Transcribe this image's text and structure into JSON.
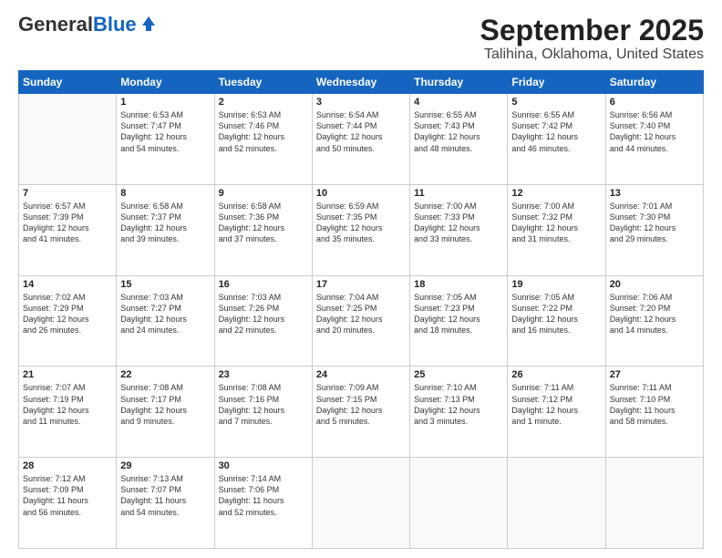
{
  "logo": {
    "line1": "General",
    "line2": "Blue"
  },
  "title": "September 2025",
  "subtitle": "Talihina, Oklahoma, United States",
  "days_of_week": [
    "Sunday",
    "Monday",
    "Tuesday",
    "Wednesday",
    "Thursday",
    "Friday",
    "Saturday"
  ],
  "weeks": [
    [
      {
        "day": "",
        "info": ""
      },
      {
        "day": "1",
        "info": "Sunrise: 6:53 AM\nSunset: 7:47 PM\nDaylight: 12 hours\nand 54 minutes."
      },
      {
        "day": "2",
        "info": "Sunrise: 6:53 AM\nSunset: 7:46 PM\nDaylight: 12 hours\nand 52 minutes."
      },
      {
        "day": "3",
        "info": "Sunrise: 6:54 AM\nSunset: 7:44 PM\nDaylight: 12 hours\nand 50 minutes."
      },
      {
        "day": "4",
        "info": "Sunrise: 6:55 AM\nSunset: 7:43 PM\nDaylight: 12 hours\nand 48 minutes."
      },
      {
        "day": "5",
        "info": "Sunrise: 6:55 AM\nSunset: 7:42 PM\nDaylight: 12 hours\nand 46 minutes."
      },
      {
        "day": "6",
        "info": "Sunrise: 6:56 AM\nSunset: 7:40 PM\nDaylight: 12 hours\nand 44 minutes."
      }
    ],
    [
      {
        "day": "7",
        "info": "Sunrise: 6:57 AM\nSunset: 7:39 PM\nDaylight: 12 hours\nand 41 minutes."
      },
      {
        "day": "8",
        "info": "Sunrise: 6:58 AM\nSunset: 7:37 PM\nDaylight: 12 hours\nand 39 minutes."
      },
      {
        "day": "9",
        "info": "Sunrise: 6:58 AM\nSunset: 7:36 PM\nDaylight: 12 hours\nand 37 minutes."
      },
      {
        "day": "10",
        "info": "Sunrise: 6:59 AM\nSunset: 7:35 PM\nDaylight: 12 hours\nand 35 minutes."
      },
      {
        "day": "11",
        "info": "Sunrise: 7:00 AM\nSunset: 7:33 PM\nDaylight: 12 hours\nand 33 minutes."
      },
      {
        "day": "12",
        "info": "Sunrise: 7:00 AM\nSunset: 7:32 PM\nDaylight: 12 hours\nand 31 minutes."
      },
      {
        "day": "13",
        "info": "Sunrise: 7:01 AM\nSunset: 7:30 PM\nDaylight: 12 hours\nand 29 minutes."
      }
    ],
    [
      {
        "day": "14",
        "info": "Sunrise: 7:02 AM\nSunset: 7:29 PM\nDaylight: 12 hours\nand 26 minutes."
      },
      {
        "day": "15",
        "info": "Sunrise: 7:03 AM\nSunset: 7:27 PM\nDaylight: 12 hours\nand 24 minutes."
      },
      {
        "day": "16",
        "info": "Sunrise: 7:03 AM\nSunset: 7:26 PM\nDaylight: 12 hours\nand 22 minutes."
      },
      {
        "day": "17",
        "info": "Sunrise: 7:04 AM\nSunset: 7:25 PM\nDaylight: 12 hours\nand 20 minutes."
      },
      {
        "day": "18",
        "info": "Sunrise: 7:05 AM\nSunset: 7:23 PM\nDaylight: 12 hours\nand 18 minutes."
      },
      {
        "day": "19",
        "info": "Sunrise: 7:05 AM\nSunset: 7:22 PM\nDaylight: 12 hours\nand 16 minutes."
      },
      {
        "day": "20",
        "info": "Sunrise: 7:06 AM\nSunset: 7:20 PM\nDaylight: 12 hours\nand 14 minutes."
      }
    ],
    [
      {
        "day": "21",
        "info": "Sunrise: 7:07 AM\nSunset: 7:19 PM\nDaylight: 12 hours\nand 11 minutes."
      },
      {
        "day": "22",
        "info": "Sunrise: 7:08 AM\nSunset: 7:17 PM\nDaylight: 12 hours\nand 9 minutes."
      },
      {
        "day": "23",
        "info": "Sunrise: 7:08 AM\nSunset: 7:16 PM\nDaylight: 12 hours\nand 7 minutes."
      },
      {
        "day": "24",
        "info": "Sunrise: 7:09 AM\nSunset: 7:15 PM\nDaylight: 12 hours\nand 5 minutes."
      },
      {
        "day": "25",
        "info": "Sunrise: 7:10 AM\nSunset: 7:13 PM\nDaylight: 12 hours\nand 3 minutes."
      },
      {
        "day": "26",
        "info": "Sunrise: 7:11 AM\nSunset: 7:12 PM\nDaylight: 12 hours\nand 1 minute."
      },
      {
        "day": "27",
        "info": "Sunrise: 7:11 AM\nSunset: 7:10 PM\nDaylight: 11 hours\nand 58 minutes."
      }
    ],
    [
      {
        "day": "28",
        "info": "Sunrise: 7:12 AM\nSunset: 7:09 PM\nDaylight: 11 hours\nand 56 minutes."
      },
      {
        "day": "29",
        "info": "Sunrise: 7:13 AM\nSunset: 7:07 PM\nDaylight: 11 hours\nand 54 minutes."
      },
      {
        "day": "30",
        "info": "Sunrise: 7:14 AM\nSunset: 7:06 PM\nDaylight: 11 hours\nand 52 minutes."
      },
      {
        "day": "",
        "info": ""
      },
      {
        "day": "",
        "info": ""
      },
      {
        "day": "",
        "info": ""
      },
      {
        "day": "",
        "info": ""
      }
    ]
  ]
}
